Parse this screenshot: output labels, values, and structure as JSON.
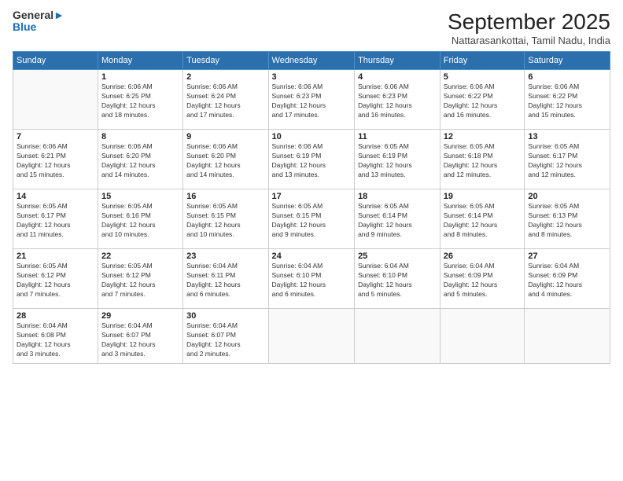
{
  "header": {
    "logo_line1": "General",
    "logo_line2": "Blue",
    "month": "September 2025",
    "location": "Nattarasankottai, Tamil Nadu, India"
  },
  "weekdays": [
    "Sunday",
    "Monday",
    "Tuesday",
    "Wednesday",
    "Thursday",
    "Friday",
    "Saturday"
  ],
  "weeks": [
    [
      {
        "day": "",
        "info": ""
      },
      {
        "day": "1",
        "info": "Sunrise: 6:06 AM\nSunset: 6:25 PM\nDaylight: 12 hours\nand 18 minutes."
      },
      {
        "day": "2",
        "info": "Sunrise: 6:06 AM\nSunset: 6:24 PM\nDaylight: 12 hours\nand 17 minutes."
      },
      {
        "day": "3",
        "info": "Sunrise: 6:06 AM\nSunset: 6:23 PM\nDaylight: 12 hours\nand 17 minutes."
      },
      {
        "day": "4",
        "info": "Sunrise: 6:06 AM\nSunset: 6:23 PM\nDaylight: 12 hours\nand 16 minutes."
      },
      {
        "day": "5",
        "info": "Sunrise: 6:06 AM\nSunset: 6:22 PM\nDaylight: 12 hours\nand 16 minutes."
      },
      {
        "day": "6",
        "info": "Sunrise: 6:06 AM\nSunset: 6:22 PM\nDaylight: 12 hours\nand 15 minutes."
      }
    ],
    [
      {
        "day": "7",
        "info": "Sunrise: 6:06 AM\nSunset: 6:21 PM\nDaylight: 12 hours\nand 15 minutes."
      },
      {
        "day": "8",
        "info": "Sunrise: 6:06 AM\nSunset: 6:20 PM\nDaylight: 12 hours\nand 14 minutes."
      },
      {
        "day": "9",
        "info": "Sunrise: 6:06 AM\nSunset: 6:20 PM\nDaylight: 12 hours\nand 14 minutes."
      },
      {
        "day": "10",
        "info": "Sunrise: 6:06 AM\nSunset: 6:19 PM\nDaylight: 12 hours\nand 13 minutes."
      },
      {
        "day": "11",
        "info": "Sunrise: 6:05 AM\nSunset: 6:19 PM\nDaylight: 12 hours\nand 13 minutes."
      },
      {
        "day": "12",
        "info": "Sunrise: 6:05 AM\nSunset: 6:18 PM\nDaylight: 12 hours\nand 12 minutes."
      },
      {
        "day": "13",
        "info": "Sunrise: 6:05 AM\nSunset: 6:17 PM\nDaylight: 12 hours\nand 12 minutes."
      }
    ],
    [
      {
        "day": "14",
        "info": "Sunrise: 6:05 AM\nSunset: 6:17 PM\nDaylight: 12 hours\nand 11 minutes."
      },
      {
        "day": "15",
        "info": "Sunrise: 6:05 AM\nSunset: 6:16 PM\nDaylight: 12 hours\nand 10 minutes."
      },
      {
        "day": "16",
        "info": "Sunrise: 6:05 AM\nSunset: 6:15 PM\nDaylight: 12 hours\nand 10 minutes."
      },
      {
        "day": "17",
        "info": "Sunrise: 6:05 AM\nSunset: 6:15 PM\nDaylight: 12 hours\nand 9 minutes."
      },
      {
        "day": "18",
        "info": "Sunrise: 6:05 AM\nSunset: 6:14 PM\nDaylight: 12 hours\nand 9 minutes."
      },
      {
        "day": "19",
        "info": "Sunrise: 6:05 AM\nSunset: 6:14 PM\nDaylight: 12 hours\nand 8 minutes."
      },
      {
        "day": "20",
        "info": "Sunrise: 6:05 AM\nSunset: 6:13 PM\nDaylight: 12 hours\nand 8 minutes."
      }
    ],
    [
      {
        "day": "21",
        "info": "Sunrise: 6:05 AM\nSunset: 6:12 PM\nDaylight: 12 hours\nand 7 minutes."
      },
      {
        "day": "22",
        "info": "Sunrise: 6:05 AM\nSunset: 6:12 PM\nDaylight: 12 hours\nand 7 minutes."
      },
      {
        "day": "23",
        "info": "Sunrise: 6:04 AM\nSunset: 6:11 PM\nDaylight: 12 hours\nand 6 minutes."
      },
      {
        "day": "24",
        "info": "Sunrise: 6:04 AM\nSunset: 6:10 PM\nDaylight: 12 hours\nand 6 minutes."
      },
      {
        "day": "25",
        "info": "Sunrise: 6:04 AM\nSunset: 6:10 PM\nDaylight: 12 hours\nand 5 minutes."
      },
      {
        "day": "26",
        "info": "Sunrise: 6:04 AM\nSunset: 6:09 PM\nDaylight: 12 hours\nand 5 minutes."
      },
      {
        "day": "27",
        "info": "Sunrise: 6:04 AM\nSunset: 6:09 PM\nDaylight: 12 hours\nand 4 minutes."
      }
    ],
    [
      {
        "day": "28",
        "info": "Sunrise: 6:04 AM\nSunset: 6:08 PM\nDaylight: 12 hours\nand 3 minutes."
      },
      {
        "day": "29",
        "info": "Sunrise: 6:04 AM\nSunset: 6:07 PM\nDaylight: 12 hours\nand 3 minutes."
      },
      {
        "day": "30",
        "info": "Sunrise: 6:04 AM\nSunset: 6:07 PM\nDaylight: 12 hours\nand 2 minutes."
      },
      {
        "day": "",
        "info": ""
      },
      {
        "day": "",
        "info": ""
      },
      {
        "day": "",
        "info": ""
      },
      {
        "day": "",
        "info": ""
      }
    ]
  ]
}
